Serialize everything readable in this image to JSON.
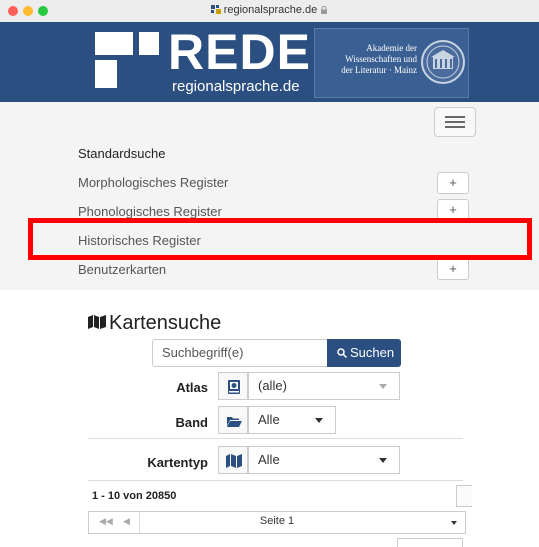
{
  "browser": {
    "url": "regionalsprache.de"
  },
  "header": {
    "logo_text": "REDE",
    "logo_sub": "regionalsprache.de",
    "akademie_lines": [
      "Akademie der",
      "Wissenschaften und",
      "der Literatur · Mainz"
    ]
  },
  "nav": {
    "items": [
      {
        "label": "Standardsuche"
      },
      {
        "label": "Morphologisches Register",
        "toggle": "+"
      },
      {
        "label": "Phonologisches Register",
        "toggle": "+"
      },
      {
        "label": "Historisches Register"
      },
      {
        "label": "Benutzerkarten",
        "toggle": "+"
      }
    ]
  },
  "kartensuche": {
    "title": "Kartensuche",
    "search_placeholder": "Suchbegriff(e)",
    "search_button": "Suchen",
    "atlas_label": "Atlas",
    "atlas_value": "(alle)",
    "band_label": "Band",
    "band_value": "Alle",
    "kartentyp_label": "Kartentyp",
    "kartentyp_value": "Alle"
  },
  "results": {
    "count_text": "1 - 10 von 20850",
    "page_label": "Seite 1"
  },
  "colors": {
    "brand": "#2b4f80",
    "highlight": "#ff0000"
  }
}
